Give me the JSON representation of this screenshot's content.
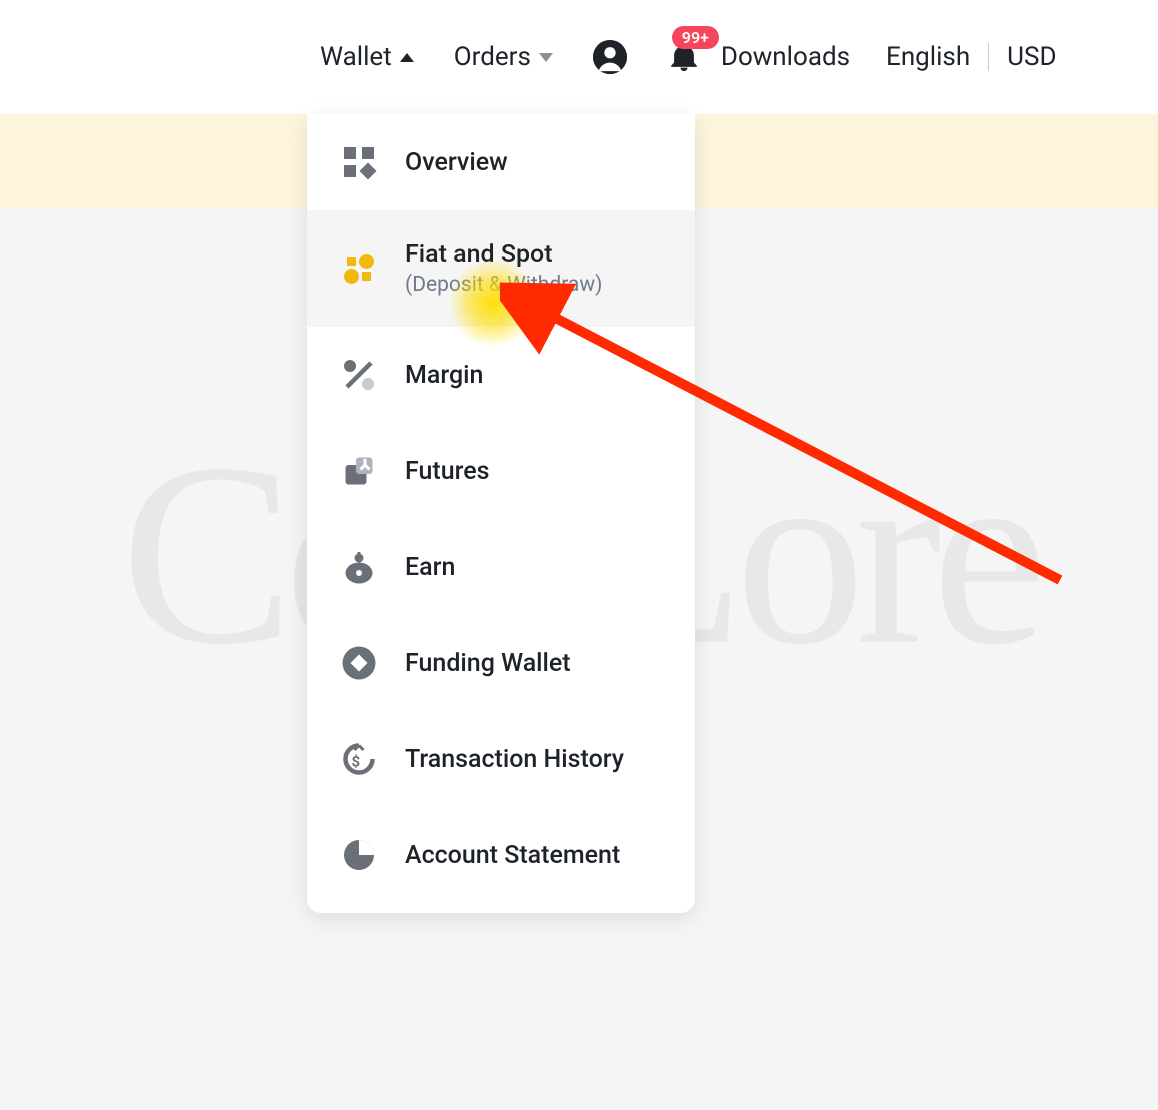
{
  "topnav": {
    "wallet": "Wallet",
    "orders": "Orders",
    "downloads": "Downloads",
    "language": "English",
    "currency": "USD",
    "notification_badge": "99+"
  },
  "dropdown": {
    "items": [
      {
        "label": "Overview",
        "sub": ""
      },
      {
        "label": "Fiat and Spot",
        "sub": "(Deposit & Withdraw)"
      },
      {
        "label": "Margin",
        "sub": ""
      },
      {
        "label": "Futures",
        "sub": ""
      },
      {
        "label": "Earn",
        "sub": ""
      },
      {
        "label": "Funding Wallet",
        "sub": ""
      },
      {
        "label": "Transaction History",
        "sub": ""
      },
      {
        "label": "Account Statement",
        "sub": ""
      }
    ]
  },
  "watermark": "CoinLore",
  "annotation": {
    "arrow_color": "#ff2a00",
    "highlight_color": "#ffde00"
  }
}
